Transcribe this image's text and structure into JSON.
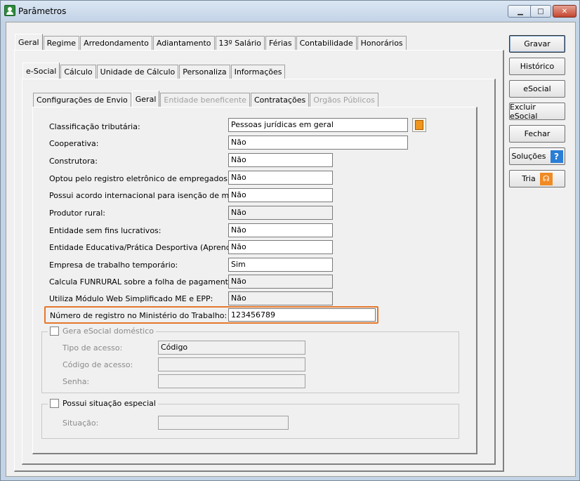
{
  "window": {
    "title": "Parâmetros"
  },
  "main_tabs": [
    "Geral",
    "Regime",
    "Arredondamento",
    "Adiantamento",
    "13º Salário",
    "Férias",
    "Contabilidade",
    "Honorários"
  ],
  "sub_tabs": [
    "e-Social",
    "Cálculo",
    "Unidade de Cálculo",
    "Personaliza",
    "Informações"
  ],
  "inner_tabs": [
    "Configurações de Envio",
    "Geral",
    "Entidade beneficente",
    "Contratações",
    "Orgãos Públicos"
  ],
  "fields": [
    {
      "label": "Classificação tributária:",
      "value": "Pessoas jurídicas em geral"
    },
    {
      "label": "Cooperativa:",
      "value": "Não"
    },
    {
      "label": "Construtora:",
      "value": "Não"
    },
    {
      "label": "Optou pelo registro eletrônico de empregados:",
      "value": "Não"
    },
    {
      "label": "Possui acordo internacional para isenção de multa:",
      "value": "Não"
    },
    {
      "label": "Produtor rural:",
      "value": "Não"
    },
    {
      "label": "Entidade sem fins lucrativos:",
      "value": "Não"
    },
    {
      "label": "Entidade Educativa/Prática Desportiva (Aprendiz):",
      "value": "Não"
    },
    {
      "label": "Empresa de trabalho temporário:",
      "value": "Sim"
    },
    {
      "label": "Calcula FUNRURAL sobre a folha de pagamento:",
      "value": "Não"
    },
    {
      "label": "Utiliza Módulo Web Simplificado ME e EPP:",
      "value": "Não"
    },
    {
      "label": "Número de registro no Ministério do Trabalho:",
      "value": "123456789"
    }
  ],
  "domestic_group": {
    "title": "Gera eSocial doméstico",
    "tipo_label": "Tipo de acesso:",
    "tipo_value": "Código",
    "codigo_label": "Código de acesso:",
    "codigo_value": "",
    "senha_label": "Senha:",
    "senha_value": ""
  },
  "special_group": {
    "title": "Possui situação especial",
    "situacao_label": "Situação:",
    "situacao_value": ""
  },
  "buttons": {
    "gravar": "Gravar",
    "historico": "Histórico",
    "esocial": "eSocial",
    "excluir": "Excluir eSocial",
    "fechar": "Fechar",
    "solucoes": "Soluções",
    "tria": "Tria"
  },
  "colors": {
    "highlight": "#e5782b",
    "help": "#2a7ed6",
    "trial": "#f08a23"
  }
}
